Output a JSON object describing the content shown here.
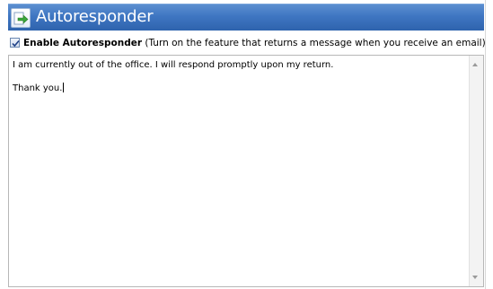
{
  "header": {
    "title": "Autoresponder",
    "icon": "autoresponder-arrow-icon",
    "background_color": "#3f76c2"
  },
  "enable": {
    "checked": true,
    "label": "Enable Autoresponder",
    "description": " (Turn on the feature that returns a message when you receive an email)"
  },
  "message": {
    "text": "I am currently out of the office. I will respond promptly upon my return.\n\nThank you."
  }
}
